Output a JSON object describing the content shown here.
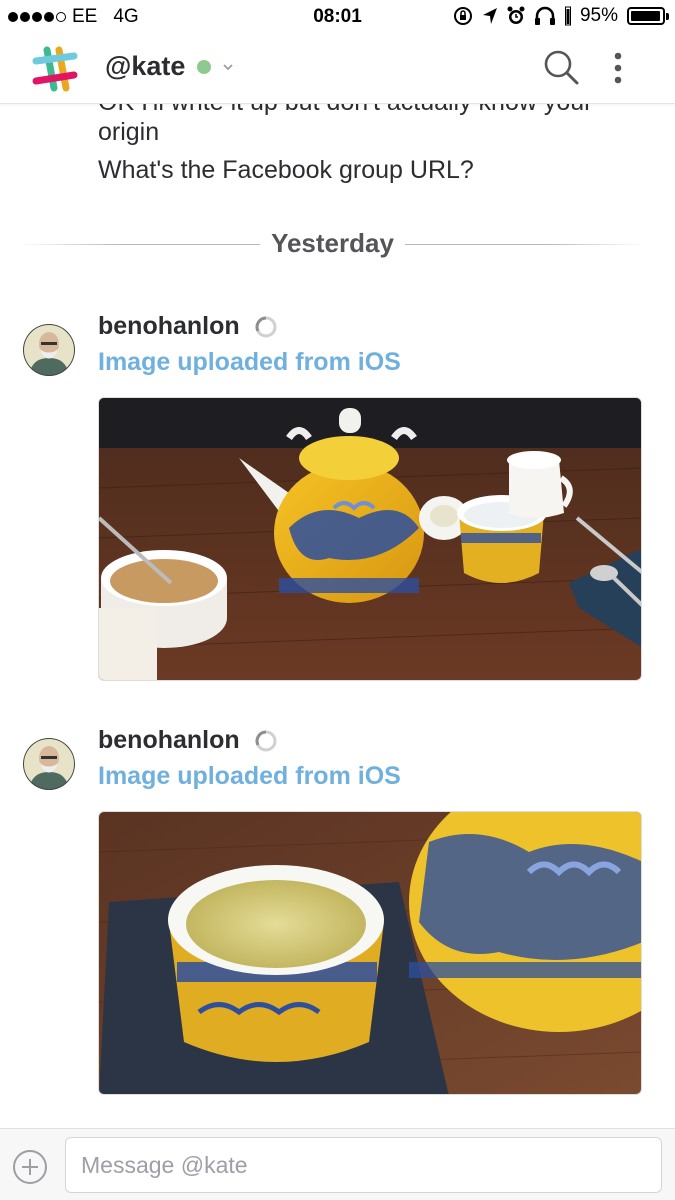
{
  "status_bar": {
    "carrier": "EE",
    "network": "4G",
    "time": "08:01",
    "battery": "95%",
    "battery_level": 0.95,
    "signal_bars": 4
  },
  "header": {
    "channel": "@kate",
    "presence_color": "#8ec98d"
  },
  "conversation": {
    "previous_lines": [
      "OK I'll write it up but don't actually know your",
      "origin",
      "What's the Facebook group URL?"
    ],
    "day_divider": "Yesterday",
    "messages": [
      {
        "author": "benohanlon",
        "file_title": "Image uploaded from iOS",
        "image": "teapot-table-photo"
      },
      {
        "author": "benohanlon",
        "file_title": "Image uploaded from iOS",
        "image": "tea-cup-closeup-photo"
      }
    ]
  },
  "composer": {
    "placeholder": "Message @kate"
  },
  "colors": {
    "link_blue": "#6fb0de",
    "text": "#2c2d30"
  }
}
